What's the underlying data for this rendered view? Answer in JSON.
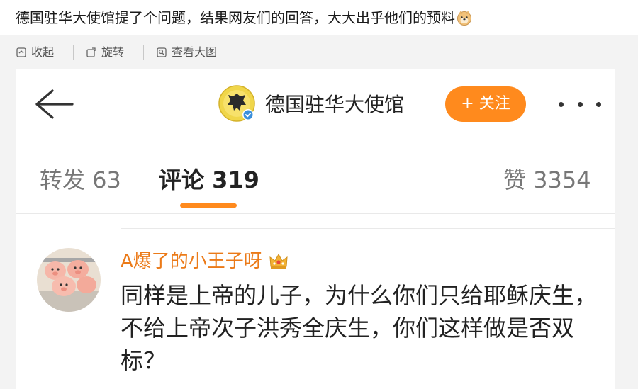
{
  "post": {
    "title": "德国驻华大使馆提了个问题，结果网友们的回答，大大出乎他们的预料"
  },
  "actions": [
    {
      "label": "收起",
      "icon": "collapse-icon"
    },
    {
      "label": "旋转",
      "icon": "rotate-icon"
    },
    {
      "label": "查看大图",
      "icon": "view-large-icon"
    }
  ],
  "header": {
    "account_name": "德国驻华大使馆",
    "follow_label": "+ 关注"
  },
  "tabs": [
    {
      "label": "转发 63",
      "active": false
    },
    {
      "label": "评论 319",
      "active": true
    },
    {
      "label": "赞 3354",
      "active": false
    }
  ],
  "comment": {
    "author": "A爆了的小王子呀",
    "text": "同样是上帝的儿子，为什么你们只给耶稣庆生，不给上帝次子洪秀全庆生，你们这样做是否双标？"
  },
  "colors": {
    "accent": "#ff8a1d",
    "username": "#eb7a18",
    "page_bg": "#f3f3f3"
  }
}
